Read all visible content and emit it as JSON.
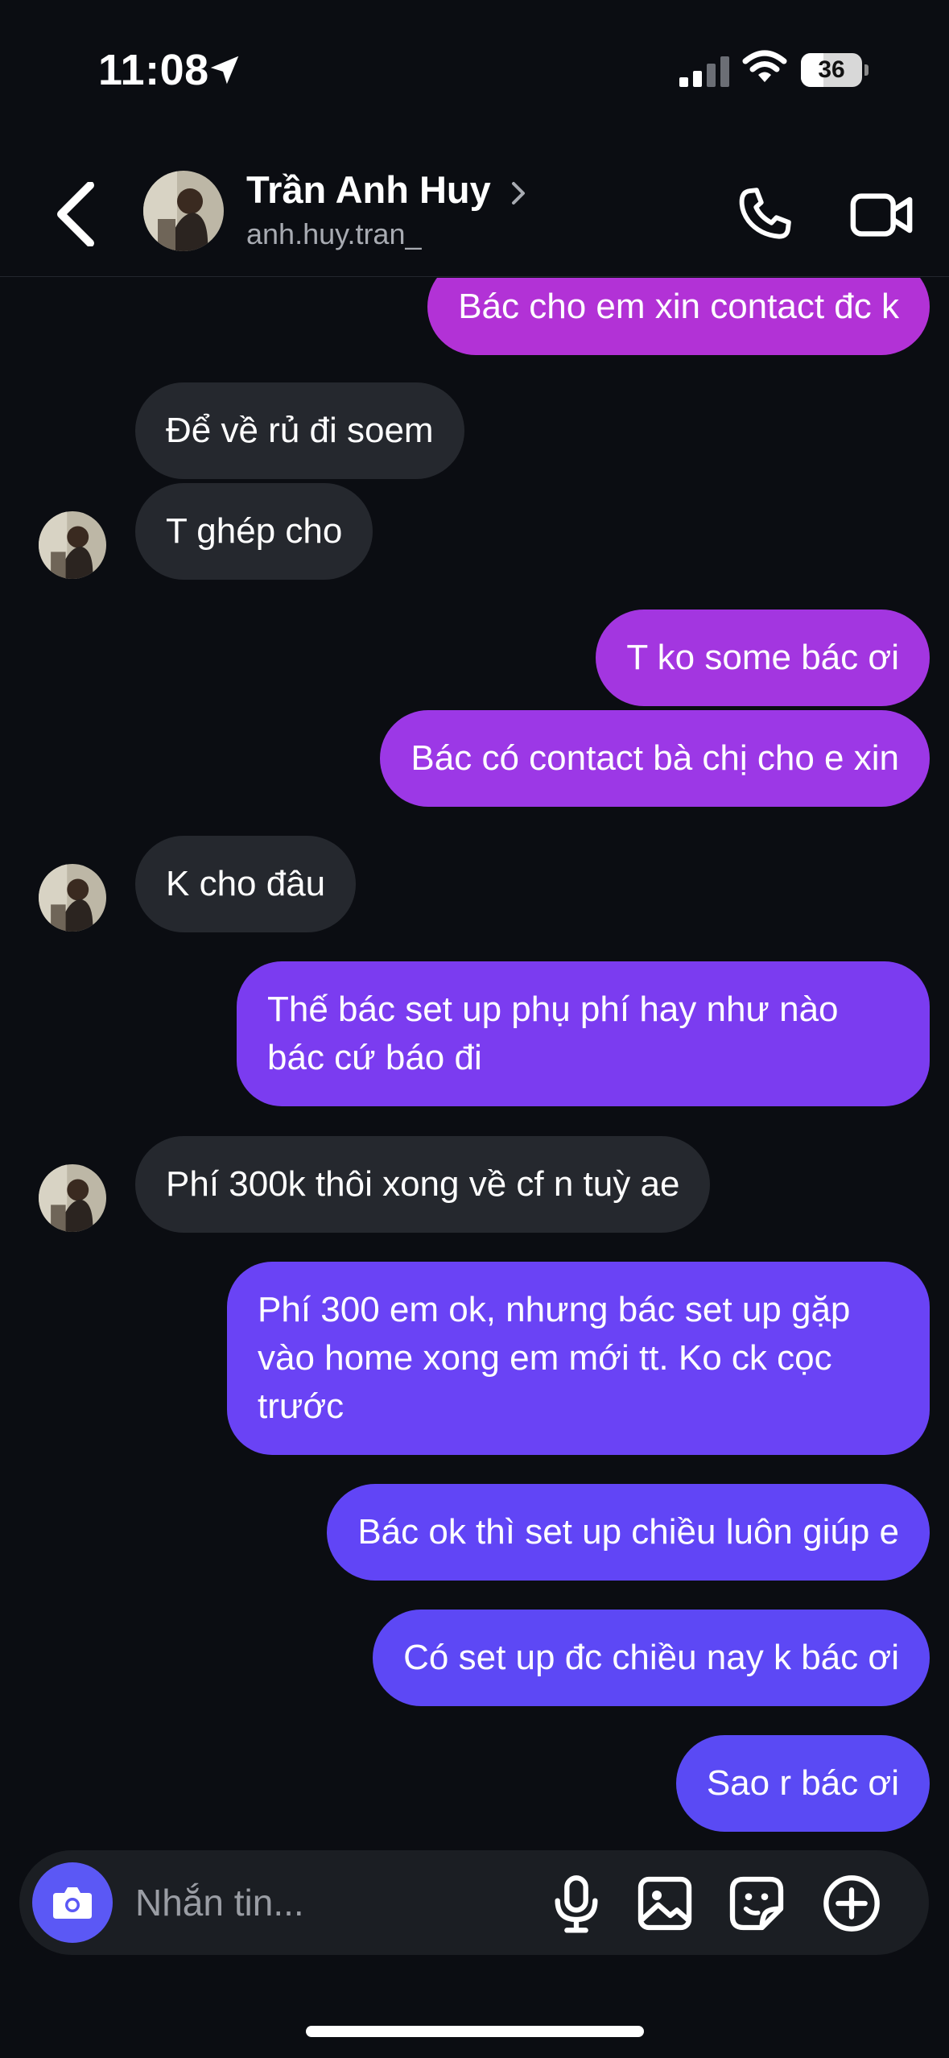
{
  "status_bar": {
    "time": "11:08",
    "battery": "36"
  },
  "header": {
    "contact_name": "Trần Anh Huy",
    "contact_handle": "anh.huy.tran_"
  },
  "messages": [
    {
      "direction": "outgoing",
      "text": "Bác cho em xin contact đc k",
      "color": "#b232d6"
    },
    {
      "direction": "incoming",
      "text": "Để về rủ đi soem"
    },
    {
      "direction": "incoming",
      "text": "T ghép cho"
    },
    {
      "direction": "outgoing",
      "text": "T ko some bác ơi",
      "color": "#a336e0"
    },
    {
      "direction": "outgoing",
      "text": "Bác có contact bà chị cho e xin",
      "color": "#9c38e6"
    },
    {
      "direction": "incoming",
      "text": "K cho đâu"
    },
    {
      "direction": "outgoing",
      "text": "Thế bác set up phụ phí hay như nào bác cứ báo đi",
      "color": "#7b3cf0"
    },
    {
      "direction": "incoming",
      "text": "Phí 300k thôi xong về cf n tuỳ ae"
    },
    {
      "direction": "outgoing",
      "text": "Phí 300 em ok, nhưng bác set up gặp vào home xong em mới tt. Ko ck cọc trước",
      "color": "#6a43f5"
    },
    {
      "direction": "outgoing",
      "text": "Bác ok thì set up chiều luôn giúp e",
      "color": "#6145f6"
    },
    {
      "direction": "outgoing",
      "text": "Có set up đc chiều nay k bác ơi",
      "color": "#5d48f5"
    },
    {
      "direction": "outgoing",
      "text": "Sao r bác ơi",
      "color": "#5a4af4"
    }
  ],
  "composer": {
    "placeholder": "Nhắn tin..."
  },
  "icons": {
    "location": "location-arrow-icon",
    "signal": "cellular-signal-icon",
    "wifi": "wifi-icon",
    "back": "chevron-left-icon",
    "call": "phone-icon",
    "video": "video-camera-icon",
    "camera": "camera-icon",
    "mic": "microphone-icon",
    "gallery": "image-icon",
    "sticker": "sticker-icon",
    "plus": "plus-circle-icon"
  },
  "colors": {
    "background": "#0b0d12",
    "incoming_bubble": "#25282e",
    "camera_button": "#5b58f5"
  }
}
